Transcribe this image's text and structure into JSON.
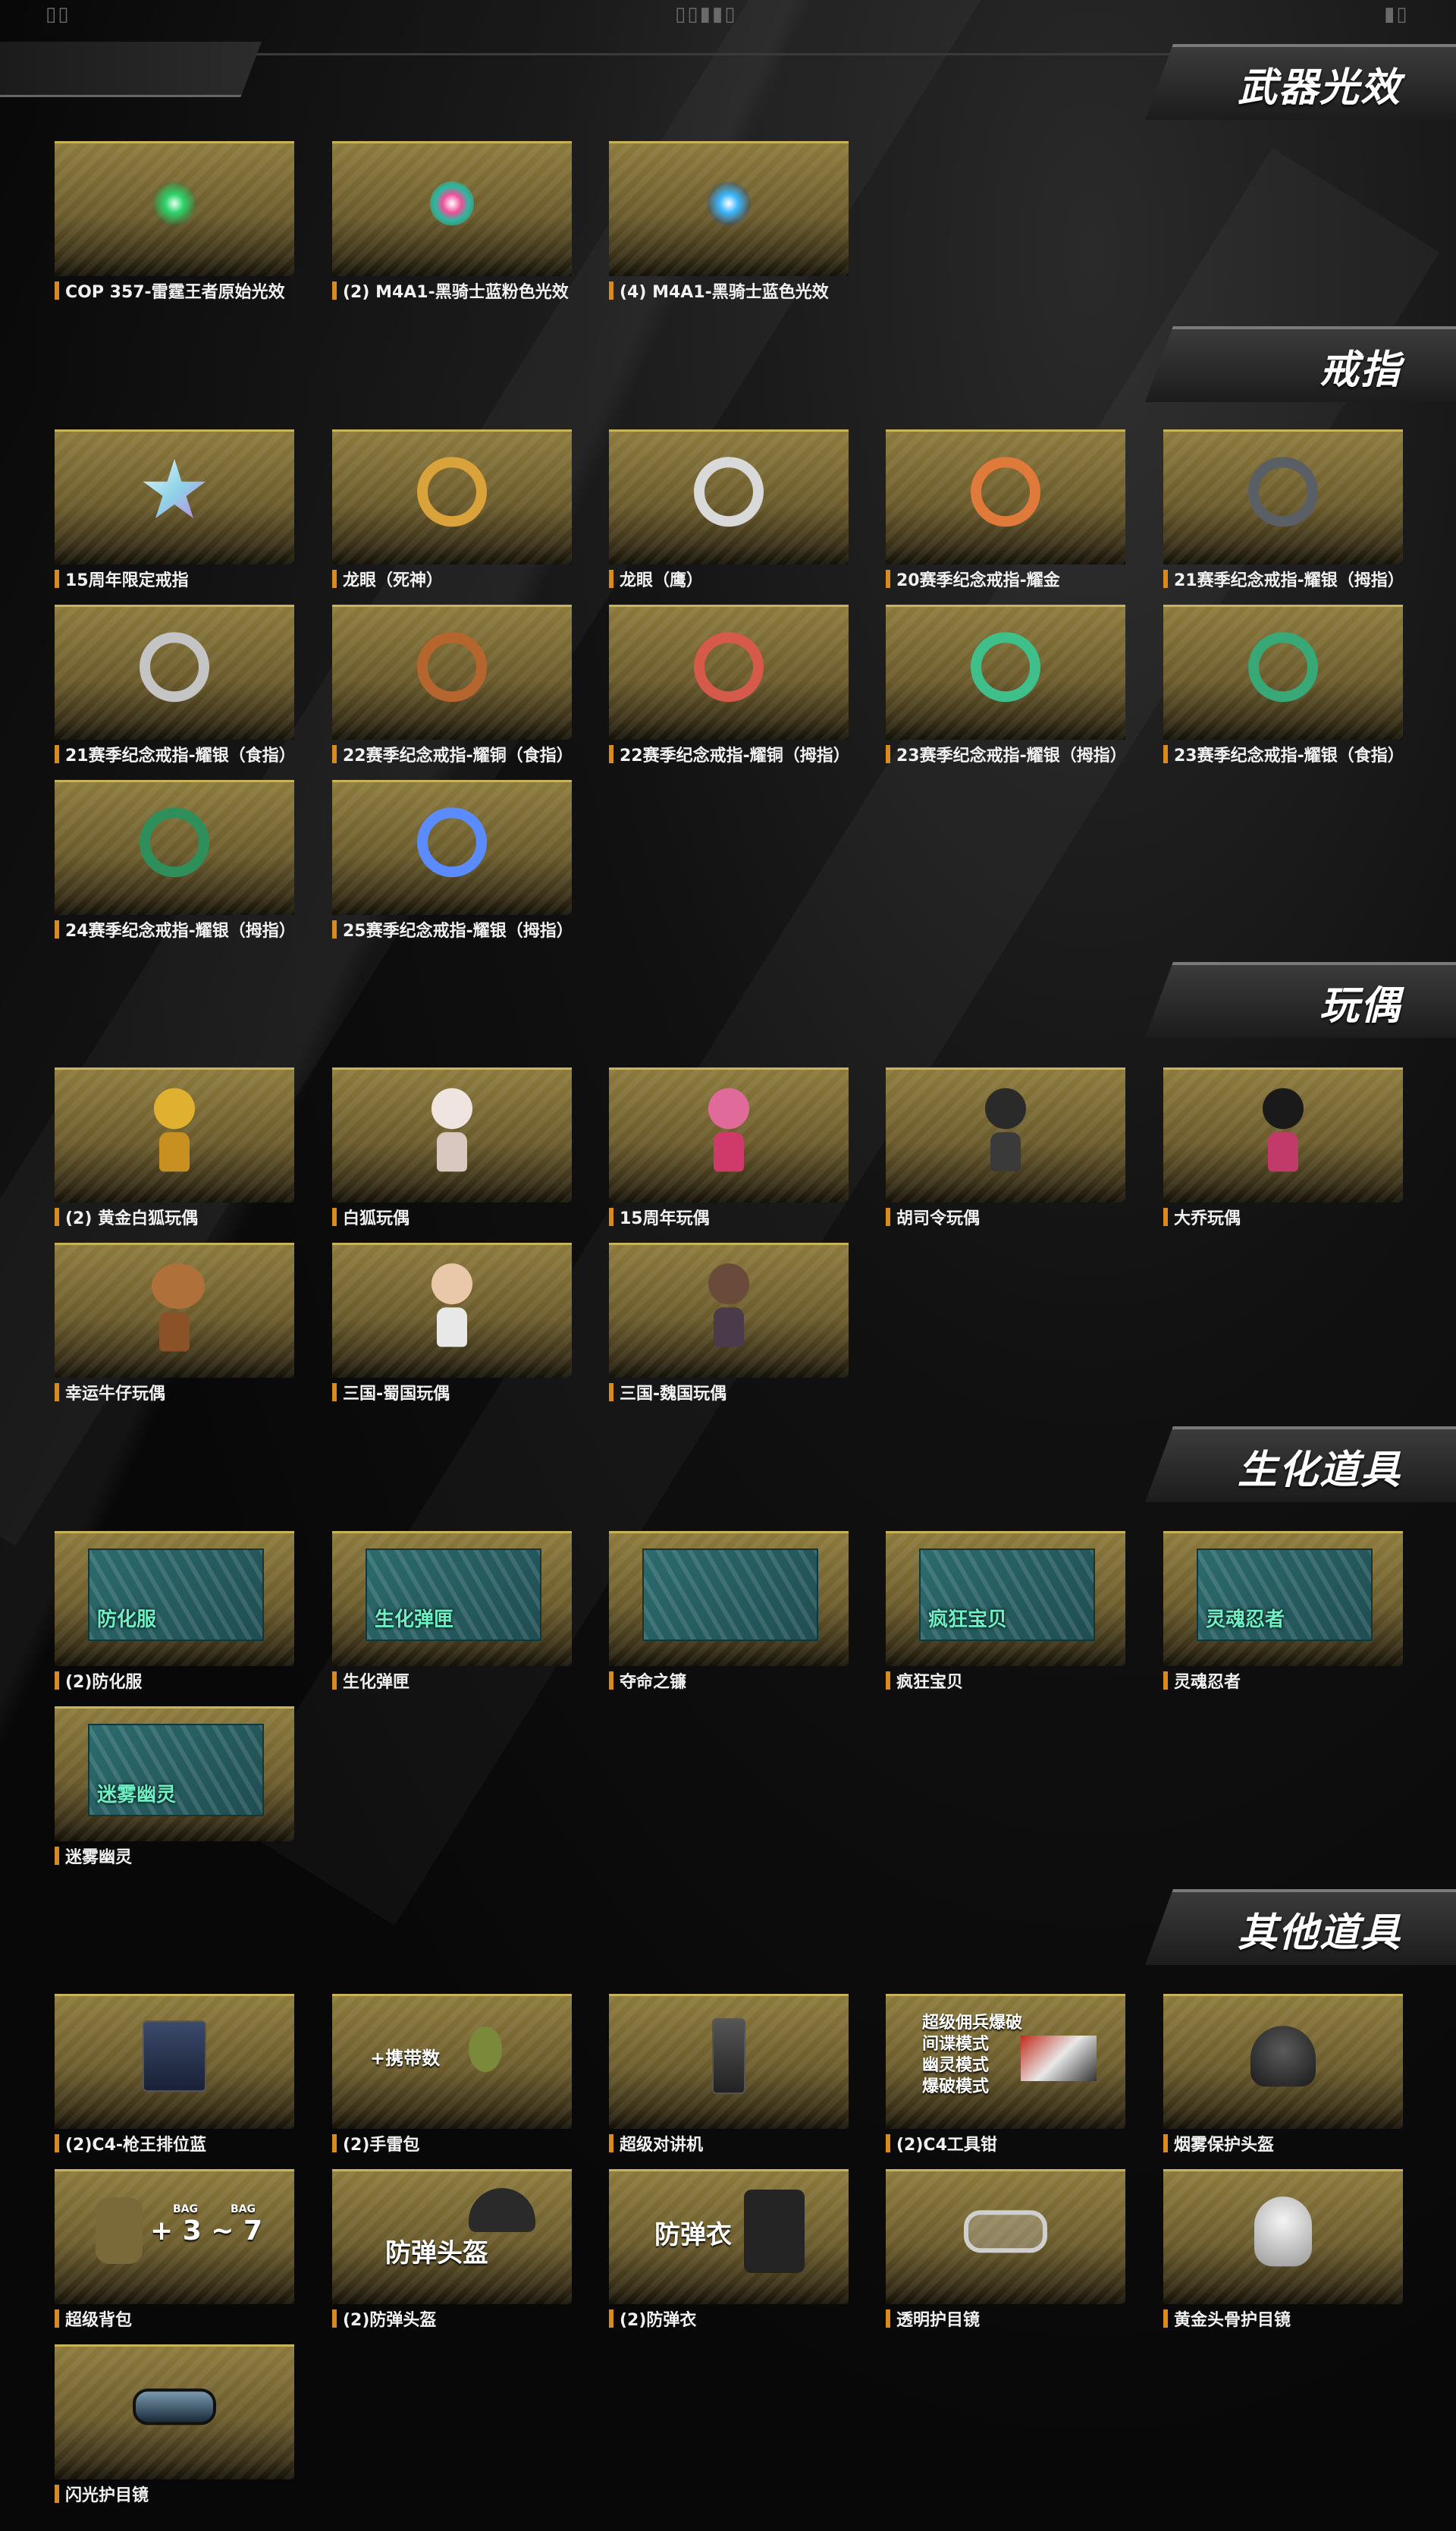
{
  "top_marks": {
    "left": "▯▯",
    "center": "▯▯▮▮▯",
    "right": "▮▯"
  },
  "colors": {
    "accent": "#d98b20",
    "tile_gold": "#8c7a3c",
    "header_bg": "#2b2b2b"
  },
  "sections": [
    {
      "title": "武器光效",
      "items": [
        {
          "label": "COP 357-雷霆王者原始光效",
          "icon": "glow-green-icon",
          "color": "#2bd46a"
        },
        {
          "label": "(2) M4A1-黑骑士蓝粉色光效",
          "icon": "glow-pink-icon",
          "color": "#f0509a"
        },
        {
          "label": "(4) M4A1-黑骑士蓝色光效",
          "icon": "glow-blue-icon",
          "color": "#3bb6ff"
        }
      ]
    },
    {
      "title": "戒指",
      "items": [
        {
          "label": "15周年限定戒指",
          "icon": "star-ring-icon",
          "color": "#8fd3e8"
        },
        {
          "label": "龙眼（死神）",
          "icon": "dragon-ring-gold-icon",
          "color": "#d9a23a"
        },
        {
          "label": "龙眼（鹰）",
          "icon": "dragon-ring-silver-icon",
          "color": "#d9d9d9"
        },
        {
          "label": "20赛季纪念戒指-耀金",
          "icon": "dragon-ring-copper-icon",
          "color": "#e07a3a"
        },
        {
          "label": "21赛季纪念戒指-耀银（拇指）",
          "icon": "tiger-ring-black-icon",
          "color": "#9aa0a8"
        },
        {
          "label": "21赛季纪念戒指-耀银（食指）",
          "icon": "tiger-ring-silver-icon",
          "color": "#c4c4c4"
        },
        {
          "label": "22赛季纪念戒指-耀铜（食指）",
          "icon": "beast-ring-bronze-icon",
          "color": "#b5652e"
        },
        {
          "label": "22赛季纪念戒指-耀铜（拇指）",
          "icon": "beast-ring-red-icon",
          "color": "#d65a4a"
        },
        {
          "label": "23赛季纪念戒指-耀银（拇指）",
          "icon": "emerald-ring-icon",
          "color": "#3fbf8a"
        },
        {
          "label": "23赛季纪念戒指-耀银（食指）",
          "icon": "emerald-ring-2-icon",
          "color": "#38a877"
        },
        {
          "label": "24赛季纪念戒指-耀银（拇指）",
          "icon": "jade-ring-icon",
          "color": "#2f8f5a"
        },
        {
          "label": "25赛季纪念戒指-耀银（拇指）",
          "icon": "sapphire-ring-icon",
          "color": "#5a8cff"
        }
      ]
    },
    {
      "title": "玩偶",
      "items": [
        {
          "label": "(2) 黄金白狐玩偶",
          "icon": "gold-fox-doll-icon",
          "color": "#e0b030"
        },
        {
          "label": "白狐玩偶",
          "icon": "white-fox-doll-icon",
          "color": "#efe4e0"
        },
        {
          "label": "15周年玩偶",
          "icon": "anniversary-doll-icon",
          "color": "#e06a9a"
        },
        {
          "label": "胡司令玩偶",
          "icon": "commander-doll-icon",
          "color": "#2a2a2a"
        },
        {
          "label": "大乔玩偶",
          "icon": "daqiao-doll-icon",
          "color": "#c23a6a"
        },
        {
          "label": "幸运牛仔玩偶",
          "icon": "lucky-cow-doll-icon",
          "color": "#b0703a"
        },
        {
          "label": "三国-蜀国玩偶",
          "icon": "shu-doll-icon",
          "color": "#e8e8e8"
        },
        {
          "label": "三国-魏国玩偶",
          "icon": "wei-doll-icon",
          "color": "#6a4a3a"
        }
      ]
    },
    {
      "title": "生化道具",
      "items": [
        {
          "label": "(2)防化服",
          "icon": "hazmat-suit-icon",
          "banner": "防化服"
        },
        {
          "label": "生化弹匣",
          "icon": "bio-magazine-icon",
          "banner": "生化弹匣"
        },
        {
          "label": "夺命之镰",
          "icon": "scythe-icon",
          "banner": ""
        },
        {
          "label": "疯狂宝贝",
          "icon": "crazy-baby-icon",
          "banner": "疯狂宝贝"
        },
        {
          "label": "灵魂忍者",
          "icon": "soul-ninja-icon",
          "banner": "灵魂忍者"
        },
        {
          "label": "迷雾幽灵",
          "icon": "mist-ghost-icon",
          "banner": "迷雾幽灵"
        }
      ]
    },
    {
      "title": "其他道具",
      "items": [
        {
          "label": "(2)C4-枪王排位蓝",
          "icon": "c4-device-icon",
          "overlay": ""
        },
        {
          "label": "(2)手雷包",
          "icon": "grenade-pack-icon",
          "overlay": "+携带数"
        },
        {
          "label": "超级对讲机",
          "icon": "walkie-talkie-icon",
          "overlay": ""
        },
        {
          "label": "(2)C4工具钳",
          "icon": "c4-pliers-icon",
          "overlay": "超级佣兵爆破\n间谍模式\n幽灵模式\n爆破模式"
        },
        {
          "label": "烟雾保护头盔",
          "icon": "smoke-helmet-icon",
          "overlay": ""
        },
        {
          "label": "超级背包",
          "icon": "backpack-icon",
          "overlay": "+ 3 ~ 7",
          "bag_labels": [
            "BAG",
            "BAG"
          ]
        },
        {
          "label": "(2)防弹头盔",
          "icon": "armor-helmet-icon",
          "overlay": "防弹头盔"
        },
        {
          "label": "(2)防弹衣",
          "icon": "armor-vest-icon",
          "overlay": "防弹衣"
        },
        {
          "label": "透明护目镜",
          "icon": "clear-goggles-icon",
          "overlay": ""
        },
        {
          "label": "黄金头骨护目镜",
          "icon": "skull-goggles-icon",
          "overlay": ""
        },
        {
          "label": "闪光护目镜",
          "icon": "flash-goggles-icon",
          "overlay": ""
        }
      ]
    }
  ]
}
